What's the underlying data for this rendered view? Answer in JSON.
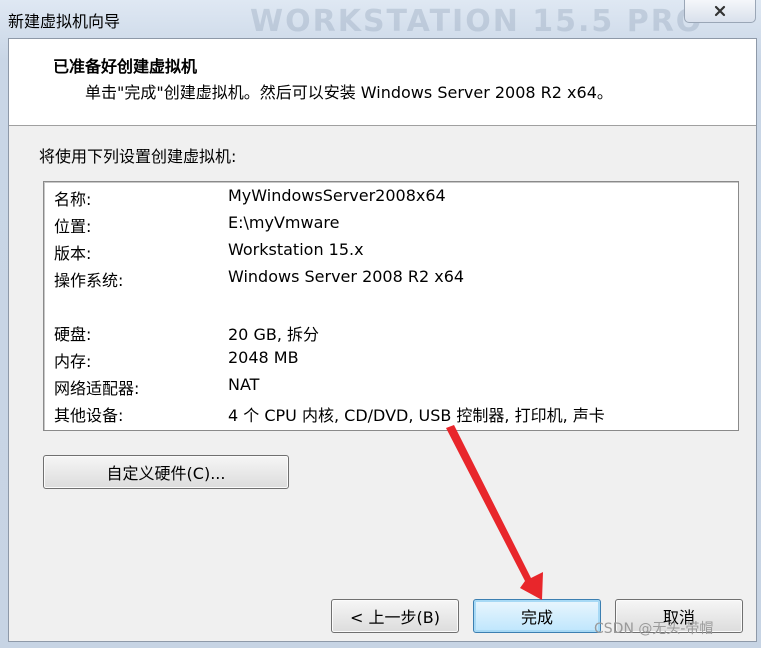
{
  "window": {
    "title": "新建虚拟机向导",
    "watermark": "WORKSTATION 15.5 PRO",
    "close_icon": "close-icon"
  },
  "header": {
    "title": "已准备好创建虚拟机",
    "subtitle": "单击\"完成\"创建虚拟机。然后可以安装 Windows Server 2008 R2 x64。"
  },
  "intro": "将使用下列设置创建虚拟机:",
  "summary": {
    "rows": [
      {
        "label": "名称:",
        "value": "MyWindowsServer2008x64"
      },
      {
        "label": "位置:",
        "value": "E:\\myVmware"
      },
      {
        "label": "版本:",
        "value": "Workstation 15.x"
      },
      {
        "label": "操作系统:",
        "value": "Windows Server 2008 R2 x64"
      },
      {
        "label": "硬盘:",
        "value": "20 GB, 拆分"
      },
      {
        "label": "内存:",
        "value": "2048 MB"
      },
      {
        "label": "网络适配器:",
        "value": "NAT"
      },
      {
        "label": "其他设备:",
        "value": "4 个 CPU 内核, CD/DVD, USB 控制器, 打印机, 声卡"
      }
    ]
  },
  "buttons": {
    "customize": "自定义硬件(C)...",
    "back": "< 上一步(B)",
    "finish": "完成",
    "cancel": "取消"
  },
  "watermark_text": "CSDN @无头-带帽",
  "colors": {
    "annotation_arrow": "#e8262b"
  }
}
